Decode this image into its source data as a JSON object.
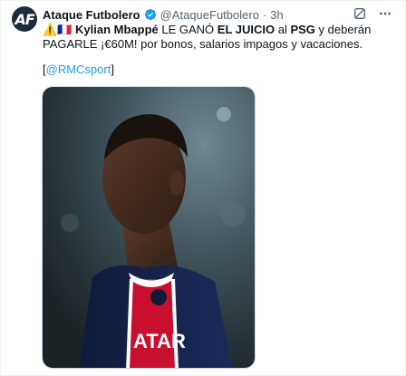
{
  "tweet": {
    "author_name": "Ataque Futbolero",
    "handle": "@AtaqueFutbolero",
    "separator": "·",
    "time": "3h",
    "flags": "⚠️🇫🇷",
    "text_parts": [
      {
        "t": " ",
        "bold": false
      },
      {
        "t": "Kylian Mbappé",
        "bold": true
      },
      {
        "t": " LE GANÓ ",
        "bold": false
      },
      {
        "t": "EL JUICIO",
        "bold": true
      },
      {
        "t": " al ",
        "bold": false
      },
      {
        "t": "PSG",
        "bold": true
      },
      {
        "t": " y deberán PAGARLE ¡€60M! por bonos, salarios impagos y vacaciones.",
        "bold": false
      }
    ],
    "source_open": "[",
    "source_link": "@RMCsport",
    "source_close": "]",
    "jersey_text": "ATAR"
  },
  "colors": {
    "accent": "#1d9bf0",
    "text": "#0f1419",
    "muted": "#536471"
  },
  "icons": {
    "verified": "verified-badge-icon",
    "grok": "grok-icon",
    "more": "more-icon"
  }
}
